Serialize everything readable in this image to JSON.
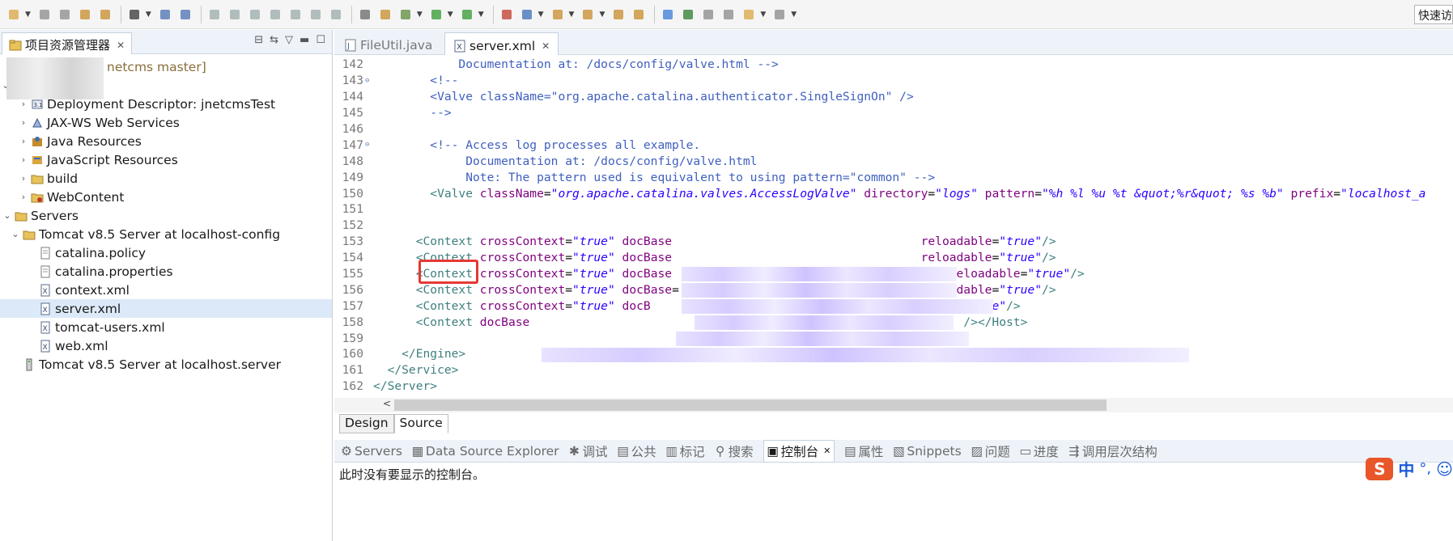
{
  "toolbar": {
    "quick_access": "快速访"
  },
  "explorer": {
    "tab_title": "项目资源管理器",
    "project_label": "netcms master]",
    "items": [
      {
        "label": "Deployment Descriptor: jnetcmsTest",
        "icon": "descriptor-icon"
      },
      {
        "label": "JAX-WS Web Services",
        "icon": "webservice-icon"
      },
      {
        "label": "Java Resources",
        "icon": "java-resources-icon"
      },
      {
        "label": "JavaScript Resources",
        "icon": "js-resources-icon"
      },
      {
        "label": "build",
        "icon": "folder-icon"
      },
      {
        "label": "WebContent",
        "icon": "webcontent-icon"
      },
      {
        "label": "Servers",
        "icon": "folder-icon"
      },
      {
        "label": "Tomcat v8.5 Server at localhost-config",
        "icon": "folder-icon"
      },
      {
        "label": "catalina.policy",
        "icon": "file-icon"
      },
      {
        "label": "catalina.properties",
        "icon": "file-icon"
      },
      {
        "label": "context.xml",
        "icon": "xml-file-icon"
      },
      {
        "label": "server.xml",
        "icon": "xml-file-icon"
      },
      {
        "label": "tomcat-users.xml",
        "icon": "xml-file-icon"
      },
      {
        "label": "web.xml",
        "icon": "xml-file-icon"
      },
      {
        "label": "Tomcat v8.5 Server at localhost.server",
        "icon": "server-icon"
      }
    ]
  },
  "editor": {
    "tabs": [
      {
        "label": "FileUtil.java",
        "active": false
      },
      {
        "label": "server.xml",
        "active": true
      }
    ],
    "lines": [
      {
        "n": "142",
        "parts": [
          [
            "c-com",
            "            Documentation at: /docs/config/valve.html -->"
          ]
        ]
      },
      {
        "n": "143",
        "fold": true,
        "parts": [
          [
            "c-com",
            "        <!--"
          ]
        ]
      },
      {
        "n": "144",
        "parts": [
          [
            "c-com",
            "        <Valve className=\"org.apache.catalina.authenticator.SingleSignOn\" />"
          ]
        ]
      },
      {
        "n": "145",
        "parts": [
          [
            "c-com",
            "        -->"
          ]
        ]
      },
      {
        "n": "146",
        "parts": []
      },
      {
        "n": "147",
        "fold": true,
        "parts": [
          [
            "c-com",
            "        <!-- Access log processes all example."
          ]
        ]
      },
      {
        "n": "148",
        "parts": [
          [
            "c-com",
            "             Documentation at: /docs/config/valve.html"
          ]
        ]
      },
      {
        "n": "149",
        "parts": [
          [
            "c-com",
            "             Note: The pattern used is equivalent to using pattern=\"common\" -->"
          ]
        ]
      },
      {
        "n": "150",
        "parts": [
          [
            "c-tag",
            "        <Valve "
          ],
          [
            "c-attr",
            "className"
          ],
          [
            "c-txt",
            "="
          ],
          [
            "c-val",
            "\"org.apache.catalina.valves.AccessLogValve\""
          ],
          [
            "c-txt",
            " "
          ],
          [
            "c-attr",
            "directory"
          ],
          [
            "c-txt",
            "="
          ],
          [
            "c-val",
            "\"logs\""
          ],
          [
            "c-txt",
            " "
          ],
          [
            "c-attr",
            "pattern"
          ],
          [
            "c-txt",
            "="
          ],
          [
            "c-val",
            "\"%h %l %u %t &quot;%r&quot; %s %b\""
          ],
          [
            "c-txt",
            " "
          ],
          [
            "c-attr",
            "prefix"
          ],
          [
            "c-txt",
            "="
          ],
          [
            "c-val",
            "\"localhost_a"
          ]
        ]
      },
      {
        "n": "151",
        "parts": []
      },
      {
        "n": "152",
        "parts": []
      },
      {
        "n": "153",
        "parts": [
          [
            "c-tag",
            "      <Context "
          ],
          [
            "c-attr",
            "crossContext"
          ],
          [
            "c-txt",
            "="
          ],
          [
            "c-val",
            "\"true\""
          ],
          [
            "c-txt",
            " "
          ],
          [
            "c-attr",
            "docBase"
          ],
          [
            "c-txt",
            "                                   "
          ],
          [
            "c-attr",
            "reloadable"
          ],
          [
            "c-txt",
            "="
          ],
          [
            "c-val",
            "\"true\""
          ],
          [
            "c-tag",
            "/>"
          ]
        ]
      },
      {
        "n": "154",
        "parts": [
          [
            "c-tag",
            "      <Context "
          ],
          [
            "c-attr",
            "crossContext"
          ],
          [
            "c-txt",
            "="
          ],
          [
            "c-val",
            "\"true\""
          ],
          [
            "c-txt",
            " "
          ],
          [
            "c-attr",
            "docBase"
          ],
          [
            "c-txt",
            "                                   "
          ],
          [
            "c-attr",
            "reloadable"
          ],
          [
            "c-txt",
            "="
          ],
          [
            "c-val",
            "\"true\""
          ],
          [
            "c-tag",
            "/>"
          ]
        ]
      },
      {
        "n": "155",
        "parts": [
          [
            "c-tag",
            "      <Context "
          ],
          [
            "c-attr",
            "crossContext"
          ],
          [
            "c-txt",
            "="
          ],
          [
            "c-val",
            "\"true\""
          ],
          [
            "c-txt",
            " "
          ],
          [
            "c-attr",
            "docBase"
          ],
          [
            "c-txt",
            "                                       "
          ],
          [
            "c-attr",
            "reloadable"
          ],
          [
            "c-txt",
            "="
          ],
          [
            "c-val",
            "\"true\""
          ],
          [
            "c-tag",
            "/>"
          ]
        ]
      },
      {
        "n": "156",
        "parts": [
          [
            "c-tag",
            "      <Context "
          ],
          [
            "c-attr",
            "crossContext"
          ],
          [
            "c-txt",
            "="
          ],
          [
            "c-val",
            "\"true\""
          ],
          [
            "c-txt",
            " "
          ],
          [
            "c-attr",
            "docBase"
          ],
          [
            "c-txt",
            "=                                  "
          ],
          [
            "c-attr",
            "reloadable"
          ],
          [
            "c-txt",
            "="
          ],
          [
            "c-val",
            "\"true\""
          ],
          [
            "c-tag",
            "/>"
          ]
        ]
      },
      {
        "n": "157",
        "parts": [
          [
            "c-tag",
            "      <Context "
          ],
          [
            "c-attr",
            "crossContext"
          ],
          [
            "c-txt",
            "="
          ],
          [
            "c-val",
            "\"true\""
          ],
          [
            "c-txt",
            " "
          ],
          [
            "c-attr",
            "docB"
          ],
          [
            "c-txt",
            "                                       "
          ],
          [
            "c-attr",
            "able"
          ],
          [
            "c-txt",
            "="
          ],
          [
            "c-val",
            "\"true\""
          ],
          [
            "c-tag",
            "/>"
          ]
        ]
      },
      {
        "n": "158",
        "parts": [
          [
            "c-tag",
            "      <Context "
          ],
          [
            "c-attr",
            "docBase"
          ],
          [
            "c-txt",
            "                                                             "
          ],
          [
            "c-tag",
            "/></Host>"
          ]
        ]
      },
      {
        "n": "159",
        "parts": []
      },
      {
        "n": "160",
        "parts": [
          [
            "c-tag",
            "    </Engine>"
          ]
        ]
      },
      {
        "n": "161",
        "parts": [
          [
            "c-tag",
            "  </Service>"
          ]
        ]
      },
      {
        "n": "162",
        "parts": [
          [
            "c-tag",
            "</Server>"
          ]
        ]
      }
    ],
    "design_tab": "Design",
    "source_tab": "Source"
  },
  "bottom": {
    "tabs": [
      {
        "label": "Servers",
        "icon": "servers-icon",
        "active": false
      },
      {
        "label": "Data Source Explorer",
        "icon": "datasource-icon",
        "active": false
      },
      {
        "label": "调试",
        "icon": "debug-icon",
        "active": false
      },
      {
        "label": "公共",
        "icon": "clipboard-icon",
        "active": false
      },
      {
        "label": "标记",
        "icon": "markers-icon",
        "active": false
      },
      {
        "label": "搜索",
        "icon": "search-icon",
        "active": false
      },
      {
        "label": "控制台",
        "icon": "console-icon",
        "active": true
      },
      {
        "label": "属性",
        "icon": "properties-icon",
        "active": false
      },
      {
        "label": "Snippets",
        "icon": "snippets-icon",
        "active": false
      },
      {
        "label": "问题",
        "icon": "problems-icon",
        "active": false
      },
      {
        "label": "进度",
        "icon": "progress-icon",
        "active": false
      },
      {
        "label": "调用层次结构",
        "icon": "hierarchy-icon",
        "active": false
      }
    ],
    "console_message": "此时没有要显示的控制台。"
  },
  "ime": {
    "logo": "S",
    "lang": "中"
  }
}
